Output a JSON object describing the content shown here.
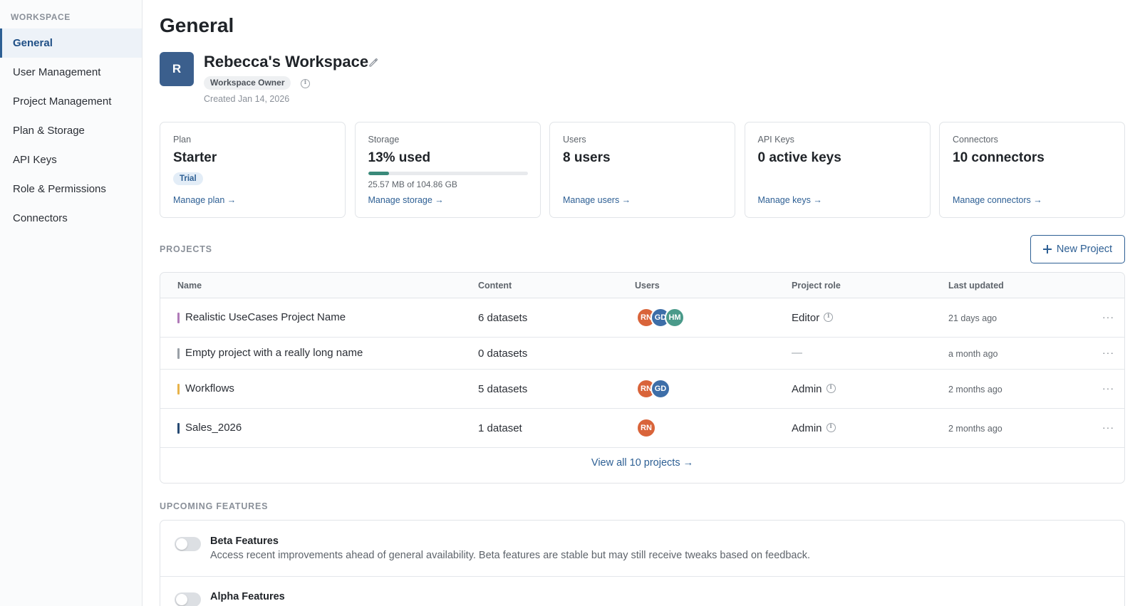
{
  "sidebar": {
    "heading": "WORKSPACE",
    "items": [
      {
        "label": "General",
        "active": true
      },
      {
        "label": "User Management"
      },
      {
        "label": "Project Management"
      },
      {
        "label": "Plan & Storage"
      },
      {
        "label": "API Keys"
      },
      {
        "label": "Role & Permissions"
      },
      {
        "label": "Connectors"
      }
    ]
  },
  "page": {
    "title": "General"
  },
  "workspace": {
    "avatar_initial": "R",
    "name": "Rebecca's Workspace",
    "role_badge": "Workspace Owner",
    "created": "Created Jan 14, 2026",
    "avatar_color": "#3b5f8d"
  },
  "cards": {
    "plan": {
      "label": "Plan",
      "value": "Starter",
      "badge": "Trial",
      "link": "Manage plan →"
    },
    "storage": {
      "label": "Storage",
      "value": "13% used",
      "used_fraction": 0.13,
      "detail": "25.57 MB of 104.86 GB",
      "link": "Manage storage →"
    },
    "users": {
      "label": "Users",
      "value": "8 users",
      "link": "Manage users →"
    },
    "api_keys": {
      "label": "API Keys",
      "value": "0 active keys",
      "link": "Manage keys →"
    },
    "connectors": {
      "label": "Connectors",
      "value": "10 connectors",
      "link": "Manage connectors →"
    }
  },
  "projects": {
    "section_label": "PROJECTS",
    "new_button": "New Project",
    "columns": [
      "Name",
      "Content",
      "Users",
      "Project role",
      "Last updated"
    ],
    "rows": [
      {
        "name": "Realistic UseCases Project Name",
        "color": "#b07ab8",
        "content": "6 datasets",
        "users": [
          "RN",
          "GD",
          "HM"
        ],
        "role": "Editor",
        "updated": "21 days ago"
      },
      {
        "name": "Empty project with a really long name",
        "color": "#9aa0a7",
        "content": "0 datasets",
        "users": [],
        "role": "—",
        "updated": "a month ago"
      },
      {
        "name": "Workflows",
        "color": "#e8b34a",
        "content": "5 datasets",
        "users": [
          "RN",
          "GD"
        ],
        "role": "Admin",
        "updated": "2 months ago"
      },
      {
        "name": "Sales_2026",
        "color": "#274a73",
        "content": "1 dataset",
        "users": [
          "RN"
        ],
        "role": "Admin",
        "updated": "2 months ago"
      }
    ],
    "view_all": "View all 10 projects →",
    "more_glyph": "···"
  },
  "avatar_colors": {
    "RN": "#d9643a",
    "GD": "#3d6ea8",
    "HM": "#4a9a8a"
  },
  "features": {
    "section_label": "UPCOMING FEATURES",
    "items": [
      {
        "title": "Beta Features",
        "description": "Access recent improvements ahead of general availability. Beta features are stable but may still receive tweaks based on feedback."
      },
      {
        "title": "Alpha Features",
        "description": ""
      }
    ]
  }
}
